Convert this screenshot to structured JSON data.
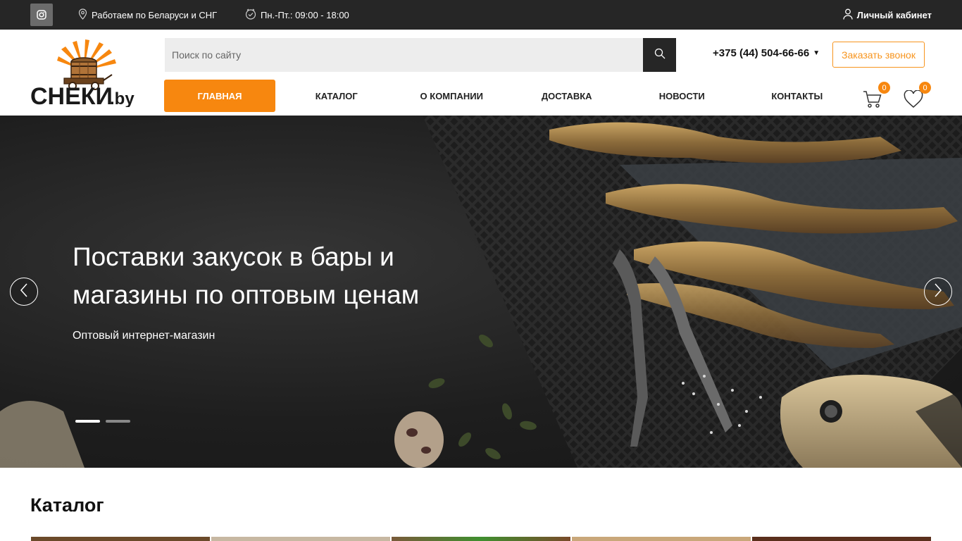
{
  "topbar": {
    "region": "Работаем по Беларуси и СНГ",
    "hours": "Пн.-Пт.: 09:00 - 18:00",
    "cabinet": "Личный кабинет"
  },
  "header": {
    "logo_text": "СНЕКИ",
    "logo_suffix": ".by",
    "search_placeholder": "Поиск по сайту",
    "phone": "+375 (44) 504-66-66",
    "callback": "Заказать звонок",
    "cart_count": "0",
    "fav_count": "0"
  },
  "nav": {
    "items": [
      "Главная",
      "Каталог",
      "О компании",
      "Доставка",
      "Новости",
      "Контакты"
    ]
  },
  "hero": {
    "title": "Поставки закусок в бары и магазины по оптовым ценам",
    "subtitle": "Оптовый интернет-магазин",
    "slides": 2,
    "active_slide": 1
  },
  "catalog": {
    "title": "Каталог"
  },
  "colors": {
    "accent": "#f7870f",
    "topbar": "#262626"
  }
}
